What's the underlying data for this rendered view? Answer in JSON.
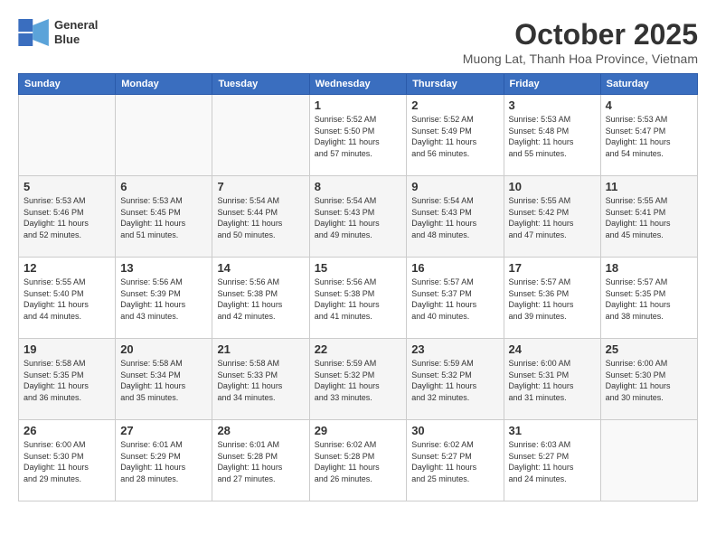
{
  "header": {
    "logo_line1": "General",
    "logo_line2": "Blue",
    "month": "October 2025",
    "location": "Muong Lat, Thanh Hoa Province, Vietnam"
  },
  "weekdays": [
    "Sunday",
    "Monday",
    "Tuesday",
    "Wednesday",
    "Thursday",
    "Friday",
    "Saturday"
  ],
  "weeks": [
    [
      {
        "day": "",
        "info": ""
      },
      {
        "day": "",
        "info": ""
      },
      {
        "day": "",
        "info": ""
      },
      {
        "day": "1",
        "info": "Sunrise: 5:52 AM\nSunset: 5:50 PM\nDaylight: 11 hours\nand 57 minutes."
      },
      {
        "day": "2",
        "info": "Sunrise: 5:52 AM\nSunset: 5:49 PM\nDaylight: 11 hours\nand 56 minutes."
      },
      {
        "day": "3",
        "info": "Sunrise: 5:53 AM\nSunset: 5:48 PM\nDaylight: 11 hours\nand 55 minutes."
      },
      {
        "day": "4",
        "info": "Sunrise: 5:53 AM\nSunset: 5:47 PM\nDaylight: 11 hours\nand 54 minutes."
      }
    ],
    [
      {
        "day": "5",
        "info": "Sunrise: 5:53 AM\nSunset: 5:46 PM\nDaylight: 11 hours\nand 52 minutes."
      },
      {
        "day": "6",
        "info": "Sunrise: 5:53 AM\nSunset: 5:45 PM\nDaylight: 11 hours\nand 51 minutes."
      },
      {
        "day": "7",
        "info": "Sunrise: 5:54 AM\nSunset: 5:44 PM\nDaylight: 11 hours\nand 50 minutes."
      },
      {
        "day": "8",
        "info": "Sunrise: 5:54 AM\nSunset: 5:43 PM\nDaylight: 11 hours\nand 49 minutes."
      },
      {
        "day": "9",
        "info": "Sunrise: 5:54 AM\nSunset: 5:43 PM\nDaylight: 11 hours\nand 48 minutes."
      },
      {
        "day": "10",
        "info": "Sunrise: 5:55 AM\nSunset: 5:42 PM\nDaylight: 11 hours\nand 47 minutes."
      },
      {
        "day": "11",
        "info": "Sunrise: 5:55 AM\nSunset: 5:41 PM\nDaylight: 11 hours\nand 45 minutes."
      }
    ],
    [
      {
        "day": "12",
        "info": "Sunrise: 5:55 AM\nSunset: 5:40 PM\nDaylight: 11 hours\nand 44 minutes."
      },
      {
        "day": "13",
        "info": "Sunrise: 5:56 AM\nSunset: 5:39 PM\nDaylight: 11 hours\nand 43 minutes."
      },
      {
        "day": "14",
        "info": "Sunrise: 5:56 AM\nSunset: 5:38 PM\nDaylight: 11 hours\nand 42 minutes."
      },
      {
        "day": "15",
        "info": "Sunrise: 5:56 AM\nSunset: 5:38 PM\nDaylight: 11 hours\nand 41 minutes."
      },
      {
        "day": "16",
        "info": "Sunrise: 5:57 AM\nSunset: 5:37 PM\nDaylight: 11 hours\nand 40 minutes."
      },
      {
        "day": "17",
        "info": "Sunrise: 5:57 AM\nSunset: 5:36 PM\nDaylight: 11 hours\nand 39 minutes."
      },
      {
        "day": "18",
        "info": "Sunrise: 5:57 AM\nSunset: 5:35 PM\nDaylight: 11 hours\nand 38 minutes."
      }
    ],
    [
      {
        "day": "19",
        "info": "Sunrise: 5:58 AM\nSunset: 5:35 PM\nDaylight: 11 hours\nand 36 minutes."
      },
      {
        "day": "20",
        "info": "Sunrise: 5:58 AM\nSunset: 5:34 PM\nDaylight: 11 hours\nand 35 minutes."
      },
      {
        "day": "21",
        "info": "Sunrise: 5:58 AM\nSunset: 5:33 PM\nDaylight: 11 hours\nand 34 minutes."
      },
      {
        "day": "22",
        "info": "Sunrise: 5:59 AM\nSunset: 5:32 PM\nDaylight: 11 hours\nand 33 minutes."
      },
      {
        "day": "23",
        "info": "Sunrise: 5:59 AM\nSunset: 5:32 PM\nDaylight: 11 hours\nand 32 minutes."
      },
      {
        "day": "24",
        "info": "Sunrise: 6:00 AM\nSunset: 5:31 PM\nDaylight: 11 hours\nand 31 minutes."
      },
      {
        "day": "25",
        "info": "Sunrise: 6:00 AM\nSunset: 5:30 PM\nDaylight: 11 hours\nand 30 minutes."
      }
    ],
    [
      {
        "day": "26",
        "info": "Sunrise: 6:00 AM\nSunset: 5:30 PM\nDaylight: 11 hours\nand 29 minutes."
      },
      {
        "day": "27",
        "info": "Sunrise: 6:01 AM\nSunset: 5:29 PM\nDaylight: 11 hours\nand 28 minutes."
      },
      {
        "day": "28",
        "info": "Sunrise: 6:01 AM\nSunset: 5:28 PM\nDaylight: 11 hours\nand 27 minutes."
      },
      {
        "day": "29",
        "info": "Sunrise: 6:02 AM\nSunset: 5:28 PM\nDaylight: 11 hours\nand 26 minutes."
      },
      {
        "day": "30",
        "info": "Sunrise: 6:02 AM\nSunset: 5:27 PM\nDaylight: 11 hours\nand 25 minutes."
      },
      {
        "day": "31",
        "info": "Sunrise: 6:03 AM\nSunset: 5:27 PM\nDaylight: 11 hours\nand 24 minutes."
      },
      {
        "day": "",
        "info": ""
      }
    ]
  ]
}
